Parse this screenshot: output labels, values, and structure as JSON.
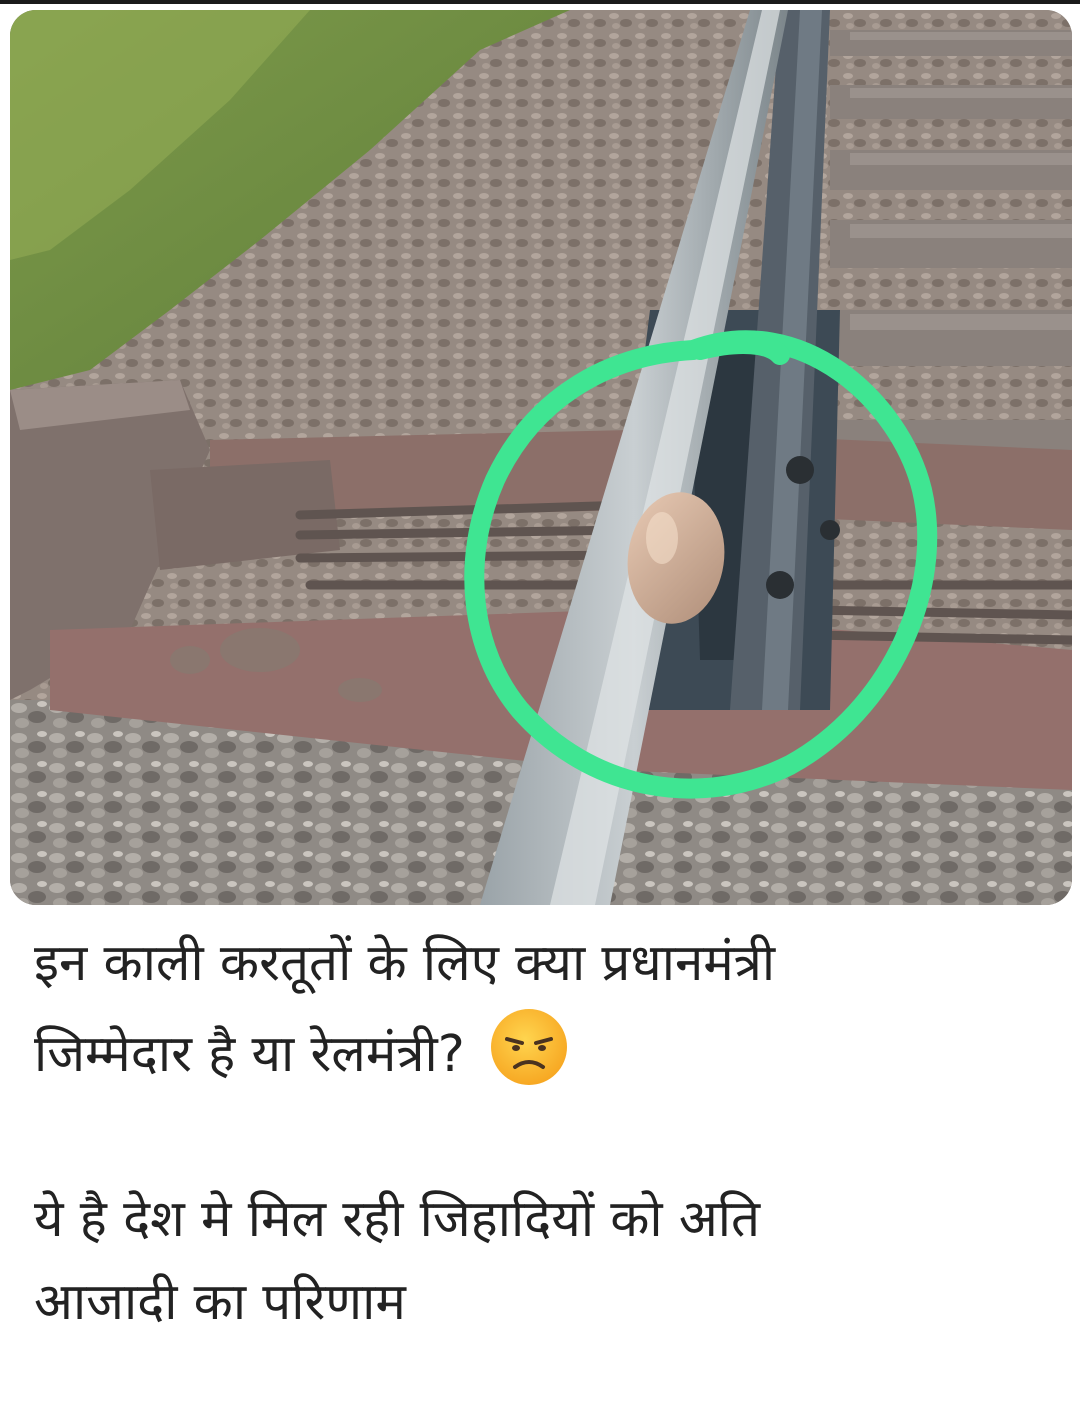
{
  "post": {
    "image": {
      "description_icon": "railway-track-photo"
    },
    "caption": {
      "line1": "इन काली करतूतों के लिए क्या प्रधानमंत्री",
      "line2": "जिम्मेदार है या रेलमंत्री?",
      "emoji": "angry-face-icon",
      "line3": "ये है देश मे मिल रही जिहादियों को अति",
      "line4": "आजादी का परिणाम"
    }
  },
  "colors": {
    "highlight_circle": "#3fe592",
    "caption_text": "#222222"
  }
}
